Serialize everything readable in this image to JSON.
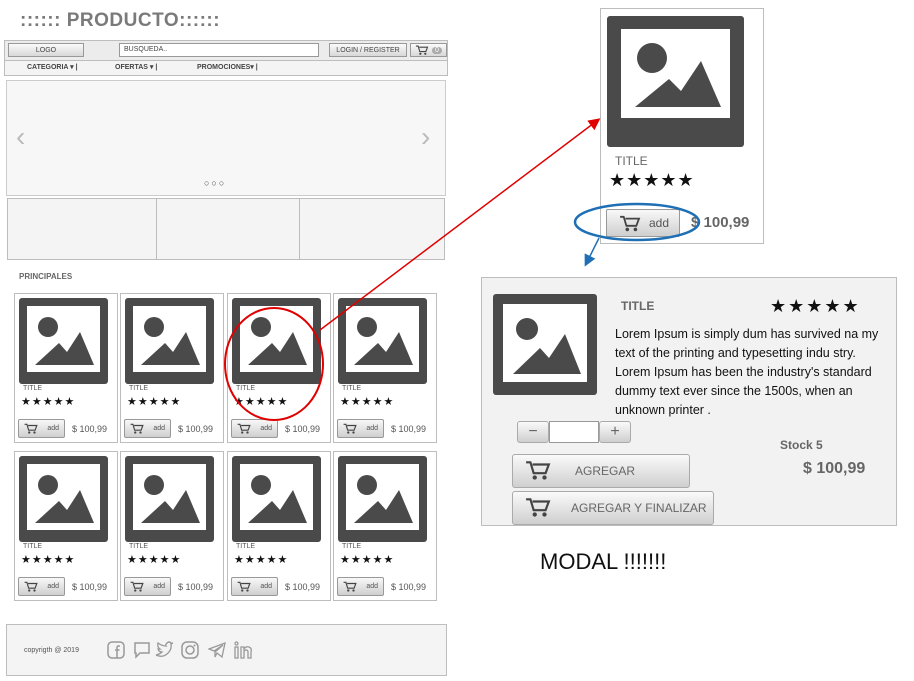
{
  "page_title": ":::::: PRODUCTO::::::",
  "header": {
    "logo": "LOGO",
    "search_placeholder": "BUSQUEDA..",
    "login": "LOGIN / REGISTER",
    "cart_count": "0"
  },
  "nav": [
    "CATEGORIA",
    "OFERTAS",
    "PROMOCIONES"
  ],
  "carousel": {
    "dots": "○○○"
  },
  "section_label": "PRINCIPALES",
  "product": {
    "title": "TITLE",
    "stars": "★★★★★",
    "add_label": "add",
    "price": "$ 100,99"
  },
  "footer": {
    "copyright": "copyrigth @ 2019"
  },
  "social_icons": [
    "facebook-icon",
    "chat-icon",
    "twitter-icon",
    "instagram-icon",
    "telegram-icon",
    "linkedin-icon"
  ],
  "detail": {
    "title": "TITLE",
    "stars": "★★★★★",
    "add_label": "add",
    "price": "$ 100,99"
  },
  "modal": {
    "title": "TITLE",
    "stars": "★★★★★",
    "description": "Lorem Ipsum is simply dum has survived na my text of the printing and typesetting indu stry. Lorem Ipsum has been the industry's standard dummy text ever since the 1500s, when an unknown printer .",
    "minus": "−",
    "plus": "+",
    "stock": "Stock 5",
    "price": "$ 100,99",
    "add_button": "AGREGAR",
    "add_finish_button": "AGREGAR Y FINALIZAR"
  },
  "modal_label": "MODAL !!!!!!!",
  "colors": {
    "annotation_red": "#e00000",
    "annotation_blue": "#1f6fb5",
    "placeholder": "#4a4a4a"
  }
}
